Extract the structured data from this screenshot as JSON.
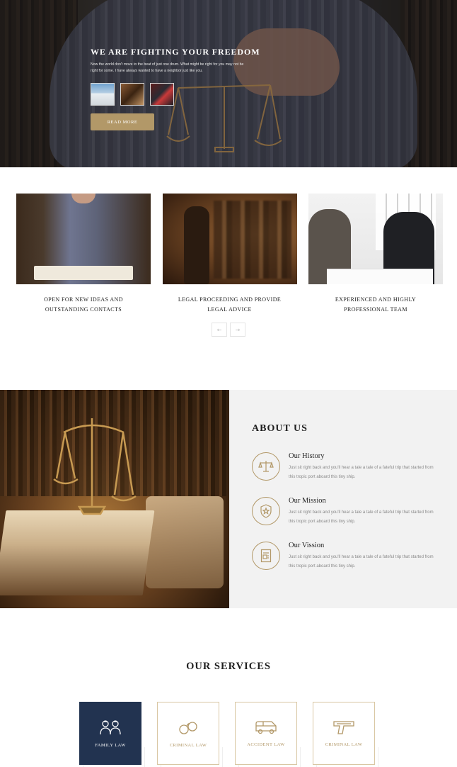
{
  "hero": {
    "title": "WE ARE FIGHTING YOUR FREEDOM",
    "subtitle": "Now the world don't move to the beat of just one drum. What might be right for you may not be right for some. I have always wanted to have a neighbor just like you.",
    "button_label": "READ MORE",
    "thumbnails": [
      "courthouse-thumbnail",
      "statue-thumbnail",
      "lawyer-thumbnail"
    ]
  },
  "features": {
    "items": [
      {
        "line1": "OPEN FOR NEW IDEAS AND",
        "line2": "OUTSTANDING CONTACTS"
      },
      {
        "line1": "LEGAL PROCEEDING AND PROVIDE",
        "line2": "LEGAL ADVICE"
      },
      {
        "line1": "EXPERIENCED AND HIGHLY",
        "line2": "PROFESSIONAL TEAM"
      }
    ],
    "prev_icon": "←",
    "next_icon": "→"
  },
  "about": {
    "title": "ABOUT US",
    "items": [
      {
        "title": "Our History",
        "text": "Just sit right back and you'll hear a tale a tale of a fateful trip that started from this tropic port aboard this tiny ship.",
        "icon": "scale-icon"
      },
      {
        "title": "Our Mission",
        "text": "Just sit right back and you'll hear a tale a tale of a fateful trip that started from this tropic port aboard this tiny ship.",
        "icon": "shield-star-icon"
      },
      {
        "title": "Our Vission",
        "text": "Just sit right back and you'll hear a tale a tale of a fateful trip that started from this tropic port aboard this tiny ship.",
        "icon": "document-icon"
      }
    ]
  },
  "services": {
    "title": "OUR SERVICES",
    "items": [
      {
        "label": "FAMILY LAW",
        "icon": "family-icon",
        "active": true
      },
      {
        "label": "CRIMINAL LAW",
        "icon": "handcuffs-icon",
        "active": false
      },
      {
        "label": "ACCIDENT LAW",
        "icon": "van-icon",
        "active": false
      },
      {
        "label": "CRIMINAL LAW",
        "icon": "gun-icon",
        "active": false
      }
    ]
  },
  "colors": {
    "accent": "#b29868",
    "navy": "#223350",
    "panel": "#f2f2f2"
  }
}
